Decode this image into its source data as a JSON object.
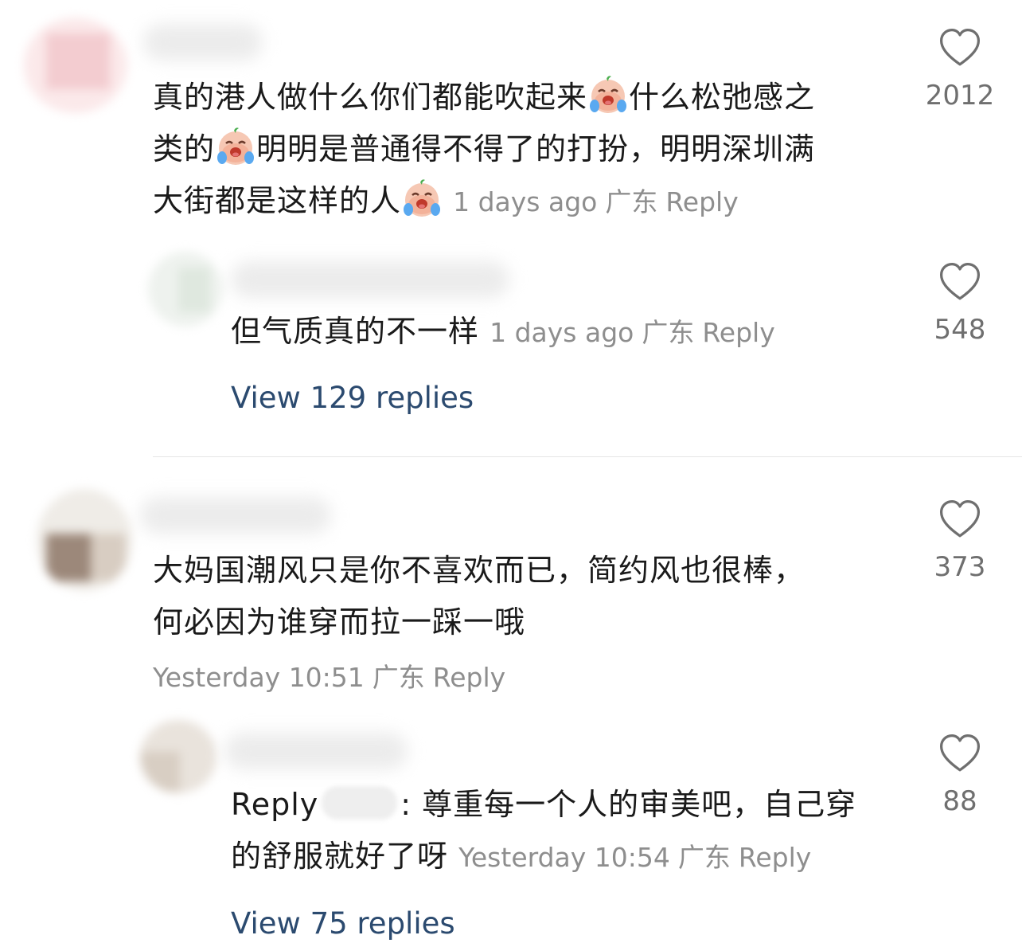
{
  "comments": [
    {
      "text_line1": "真的港人做什么你们都能吹起来",
      "text_line1b": "什么松弛感之",
      "text_line2a": "类的",
      "text_line2b": "明明是普通得不得了的打扮，明明深圳满",
      "text_line3": "大街都是这样的人",
      "time": "1 days ago",
      "region": "广东",
      "reply_label": "Reply",
      "likes": "2012",
      "emoji": "crying-face-emoji"
    },
    {
      "text": "但气质真的不一样",
      "time": "1 days ago",
      "region": "广东",
      "reply_label": "Reply",
      "likes": "548"
    },
    {
      "view_replies": "View 129 replies"
    },
    {
      "text_line1": "大妈国潮风只是你不喜欢而已，简约风也很棒，",
      "text_line2": "何必因为谁穿而拉一踩一哦",
      "time": "Yesterday 10:51",
      "region": "广东",
      "reply_label": "Reply",
      "likes": "373"
    },
    {
      "reply_prefix": "Reply",
      "text_line1": ": 尊重每一个人的审美吧，自己穿",
      "text_line2": "的舒服就好了呀",
      "time": "Yesterday 10:54",
      "region": "广东",
      "reply_label": "Reply",
      "likes": "88"
    },
    {
      "view_replies": "View 75 replies"
    }
  ],
  "colors": {
    "link": "#2b4a6f",
    "meta": "#8e8e8e",
    "text": "#1a1a1a"
  }
}
